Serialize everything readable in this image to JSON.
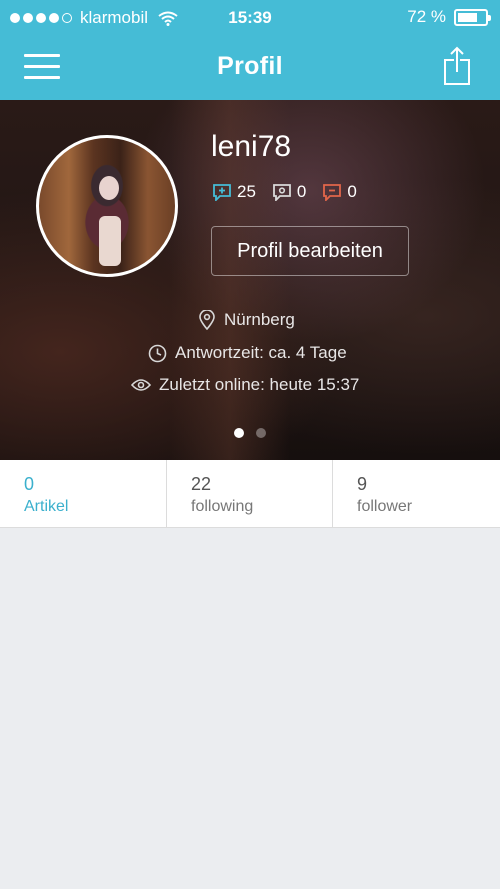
{
  "status_bar": {
    "carrier": "klarmobil",
    "time": "15:39",
    "battery": "72 %",
    "battery_level": 0.72,
    "signal_bars": 4
  },
  "nav": {
    "title": "Profil",
    "menu_icon": "hamburger-menu-icon",
    "share_icon": "share-icon"
  },
  "profile": {
    "username": "leni78",
    "stats": [
      {
        "icon": "plus-comment-icon",
        "value": "25",
        "color": "#45bcd6"
      },
      {
        "icon": "neutral-comment-icon",
        "value": "0",
        "color": "#d9d9d9"
      },
      {
        "icon": "minus-comment-icon",
        "value": "0",
        "color": "#e2664a"
      }
    ],
    "edit_button": "Profil bearbeiten",
    "location": "Nürnberg",
    "response_time": "Antwortzeit: ca. 4 Tage",
    "last_online": "Zuletzt online: heute 15:37",
    "pager": {
      "pages": 2,
      "active": 1
    }
  },
  "tabs": [
    {
      "count": "0",
      "label": "Artikel",
      "active": true
    },
    {
      "count": "22",
      "label": "following",
      "active": false
    },
    {
      "count": "9",
      "label": "follower",
      "active": false
    }
  ],
  "colors": {
    "accent": "#45bcd6",
    "background": "#ebedf0"
  }
}
